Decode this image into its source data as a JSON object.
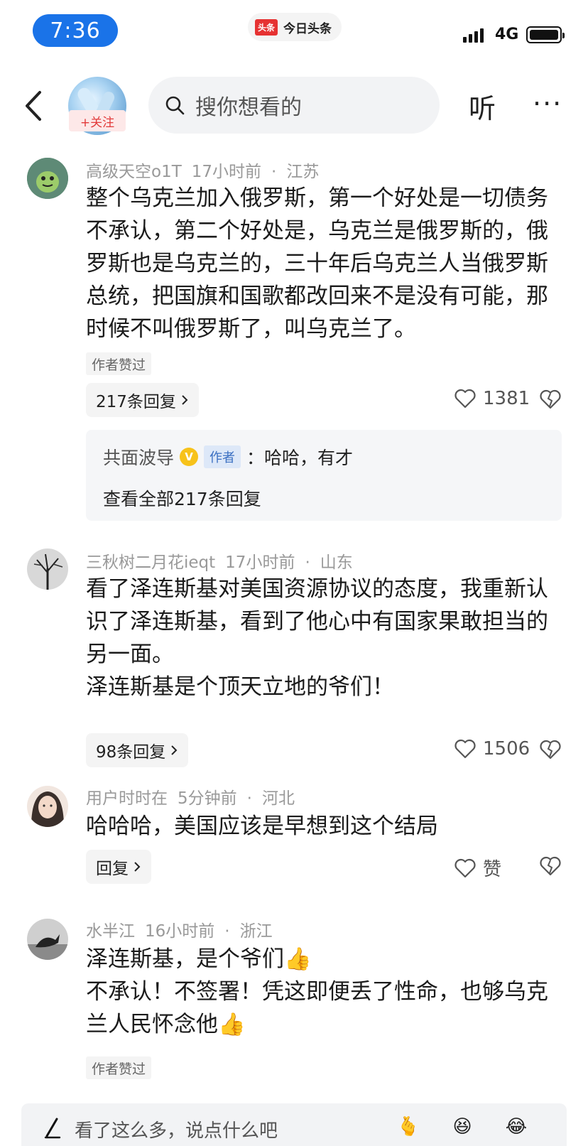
{
  "status_bar": {
    "time": "7:36",
    "network": "4G",
    "app_badge_logo": "头条",
    "app_badge_text": "今日头条"
  },
  "header": {
    "follow_label": "+关注",
    "search_placeholder": "搜你想看的",
    "listen_label": "听",
    "more_label": "···"
  },
  "comments": [
    {
      "username": "高级天空o1T",
      "time": "17小时前",
      "location": "江苏",
      "text": "整个乌克兰加入俄罗斯，第一个好处是一切债务不承认，第二个好处是，乌克兰是俄罗斯的，俄罗斯也是乌克兰的，三十年后乌克兰人当俄罗斯总统，把国旗和国歌都改回来不是没有可能，那时候不叫俄罗斯了，叫乌克兰了。",
      "author_liked": "作者赞过",
      "replies_label": "217条回复",
      "likes": "1381",
      "reply_preview": {
        "name": "共面波导",
        "verified": "V",
        "author_tag": "作者",
        "text": "：哈哈，有才",
        "view_all": "查看全部217条回复"
      }
    },
    {
      "username": "三秋树二月花ieqt",
      "time": "17小时前",
      "location": "山东",
      "text_lines": [
        "看了泽连斯基对美国资源协议的态度，我重新认识了泽连斯基，看到了他心中有国家果敢担当的另一面。",
        "泽连斯基是个顶天立地的爷们！"
      ],
      "replies_label": "98条回复",
      "likes": "1506"
    },
    {
      "username": "用户时时在",
      "time": "5分钟前",
      "location": "河北",
      "text": "哈哈哈，美国应该是早想到这个结局",
      "replies_label": "回复",
      "likes": "赞"
    },
    {
      "username": "水半江",
      "time": "16小时前",
      "location": "浙江",
      "text_lines": [
        "泽连斯基，是个爷们👍",
        "不承认！不签署！凭这即便丢了性命，也够乌克兰人民怀念他👍"
      ],
      "author_liked": "作者赞过"
    }
  ],
  "meta_separator": "·",
  "bottom_bar": {
    "placeholder": "看了这么多，说点什么吧",
    "emojis": [
      "🫰",
      "😆",
      "😂"
    ]
  },
  "colors": {
    "accent_blue": "#1a73e8",
    "follow_red": "#e23a3a",
    "verified_gold": "#f7c21a"
  }
}
